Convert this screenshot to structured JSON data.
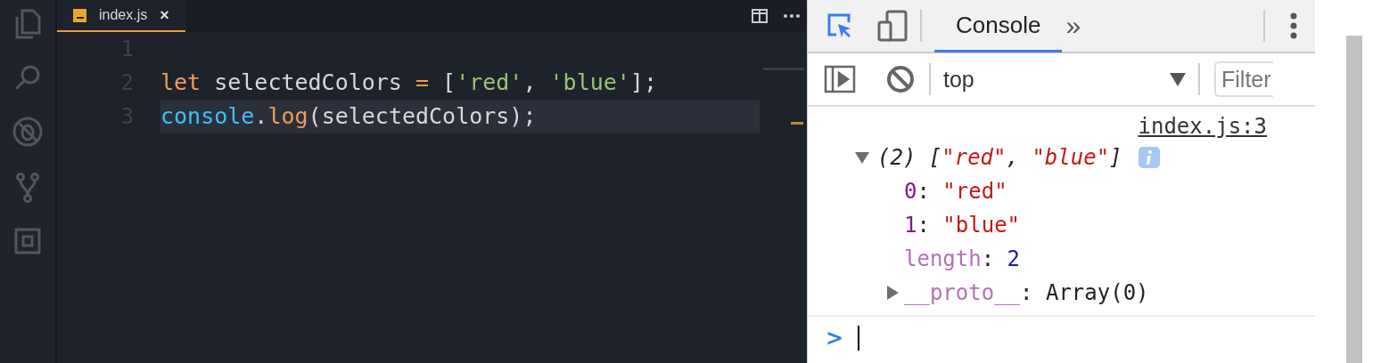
{
  "activity_bar": {
    "items": [
      {
        "kind": "files",
        "selected": false
      },
      {
        "kind": "search",
        "selected": false
      },
      {
        "kind": "debug",
        "selected": false
      },
      {
        "kind": "scm",
        "selected": false
      },
      {
        "kind": "extensions",
        "selected": false
      }
    ]
  },
  "editor": {
    "tabs": [
      {
        "label": "index.js",
        "selected": true,
        "close": "×"
      }
    ],
    "lines": [
      {
        "number": "1",
        "current": false
      },
      {
        "number": "2",
        "current": false,
        "tokens": [
          {
            "kind": "keyword",
            "text": "let"
          },
          {
            "kind": "plain",
            "text": " selectedColors "
          },
          {
            "kind": "keyword",
            "text": "="
          },
          {
            "kind": "plain",
            "text": " ["
          },
          {
            "kind": "string",
            "text": "'red'"
          },
          {
            "kind": "plain",
            "text": ", "
          },
          {
            "kind": "string",
            "text": "'blue'"
          },
          {
            "kind": "plain",
            "text": "];"
          }
        ]
      },
      {
        "number": "3",
        "current": true,
        "tokens": [
          {
            "kind": "builtin",
            "text": "console"
          },
          {
            "kind": "plain",
            "text": "."
          },
          {
            "kind": "function",
            "text": "log"
          },
          {
            "kind": "plain",
            "text": "(selectedColors);"
          }
        ]
      }
    ]
  },
  "devtools": {
    "tabs": [
      {
        "label": "Console",
        "selected": true
      }
    ],
    "more_tabs": "»",
    "inspect_selected": true,
    "context": {
      "value": "top"
    },
    "filter": {
      "placeholder": "Filter"
    },
    "messages": [
      {
        "source": "index.js:3",
        "expanded": true,
        "summary": [
          {
            "kind": "plain",
            "text": "(2) ["
          },
          {
            "kind": "string",
            "text": "\"red\""
          },
          {
            "kind": "plain",
            "text": ", "
          },
          {
            "kind": "string",
            "text": "\"blue\""
          },
          {
            "kind": "plain",
            "text": "]"
          }
        ],
        "children": [
          {
            "tokens": [
              {
                "kind": "index",
                "text": "0"
              },
              {
                "kind": "plain",
                "text": ": "
              },
              {
                "kind": "string",
                "text": "\"red\""
              }
            ]
          },
          {
            "tokens": [
              {
                "kind": "index",
                "text": "1"
              },
              {
                "kind": "plain",
                "text": ": "
              },
              {
                "kind": "string",
                "text": "\"blue\""
              }
            ]
          },
          {
            "tokens": [
              {
                "kind": "meta",
                "text": "length"
              },
              {
                "kind": "plain",
                "text": ": "
              },
              {
                "kind": "number",
                "text": "2"
              }
            ]
          },
          {
            "expanded": false,
            "tokens": [
              {
                "kind": "meta",
                "text": "__proto__"
              },
              {
                "kind": "plain",
                "text": ": "
              },
              {
                "kind": "plain",
                "text": "Array(0)"
              }
            ]
          }
        ]
      }
    ],
    "prompt": ">"
  }
}
